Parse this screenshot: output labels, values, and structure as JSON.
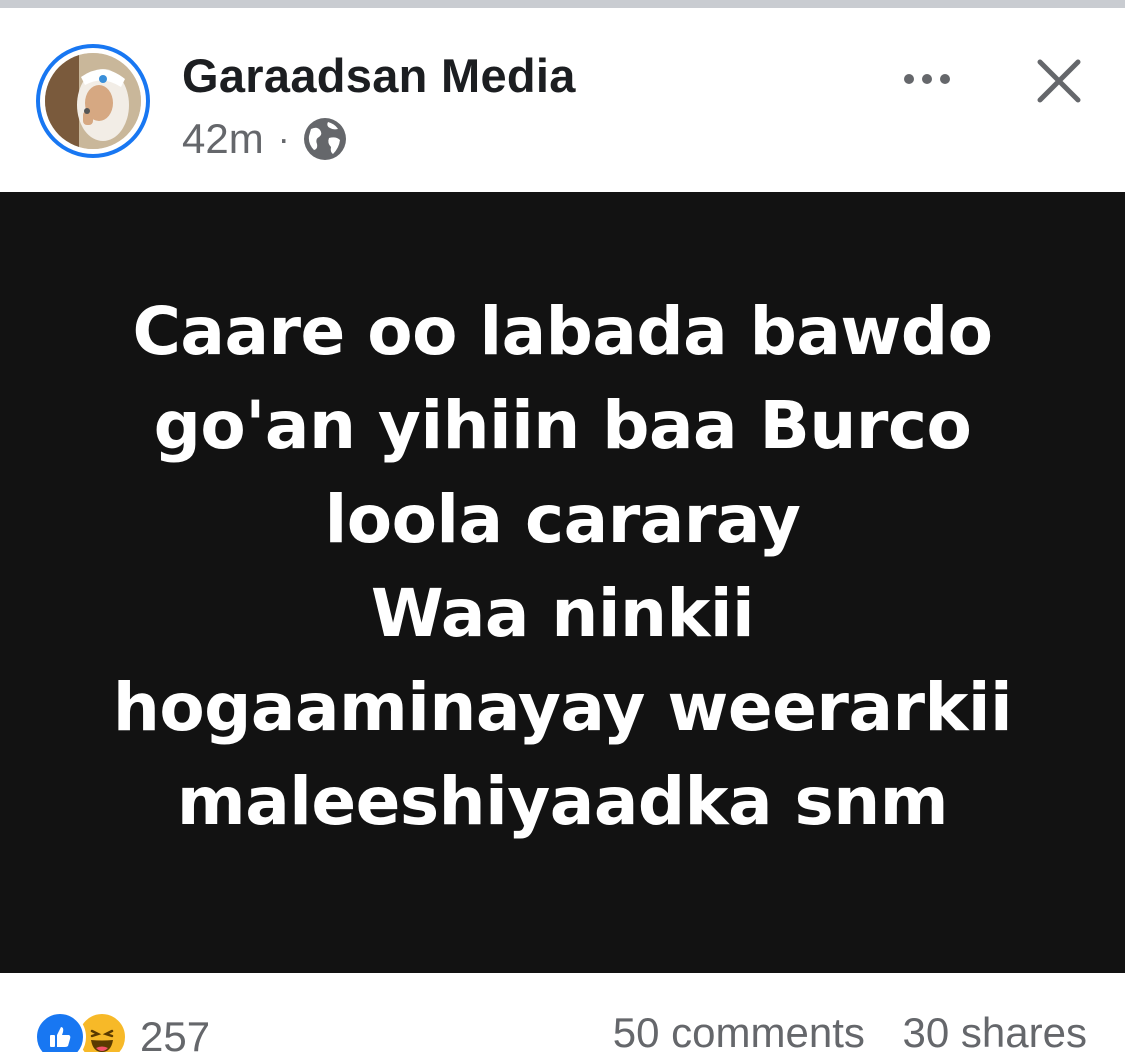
{
  "post": {
    "page_name": "Garaadsan Media",
    "time": "42m",
    "separator": "·",
    "privacy_icon": "globe-icon",
    "more_icon": "more-horizontal-icon",
    "close_icon": "close-icon",
    "headline_lines": [
      "Caare oo labada bawdo",
      "go'an yihiin baa Burco",
      "loola cararay",
      "Waa ninkii",
      "hogaaminayay weerarkii",
      "maleeshiyaadka snm"
    ],
    "image_background": "#121212",
    "image_text_color": "#ffffff"
  },
  "footer": {
    "reaction_icons": [
      "like-icon",
      "haha-icon"
    ],
    "reaction_count": "257",
    "comments": "50 comments",
    "shares": "30 shares"
  },
  "colors": {
    "accent": "#1877f2",
    "secondary_text": "#65676b",
    "primary_text": "#1c1e21"
  }
}
